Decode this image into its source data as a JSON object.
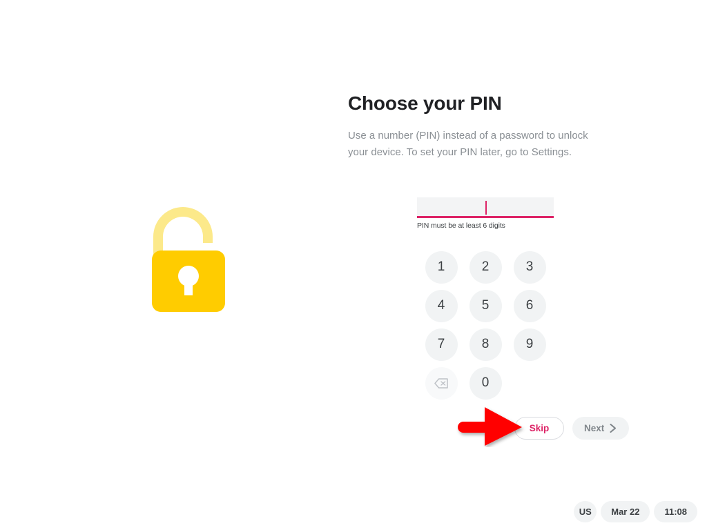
{
  "screen": {
    "title": "Choose your PIN",
    "subtitle": "Use a number (PIN) instead of a password to unlock your device. To set your PIN later, go to Settings."
  },
  "illustration": {
    "icon": "open-padlock-icon",
    "body_color": "#FFCC00",
    "shackle_color": "#FCE98A",
    "keyhole_color": "#FFFFFF"
  },
  "pin_field": {
    "value": "",
    "placeholder": "",
    "hint": "PIN must be at least 6 digits",
    "underline_color": "#DD2366",
    "caret_color": "#DD2366",
    "background": "#F3F4F5"
  },
  "keypad": {
    "keys": [
      {
        "label": "1",
        "name": "keypad-key-1",
        "type": "digit"
      },
      {
        "label": "2",
        "name": "keypad-key-2",
        "type": "digit"
      },
      {
        "label": "3",
        "name": "keypad-key-3",
        "type": "digit"
      },
      {
        "label": "4",
        "name": "keypad-key-4",
        "type": "digit"
      },
      {
        "label": "5",
        "name": "keypad-key-5",
        "type": "digit"
      },
      {
        "label": "6",
        "name": "keypad-key-6",
        "type": "digit"
      },
      {
        "label": "7",
        "name": "keypad-key-7",
        "type": "digit"
      },
      {
        "label": "8",
        "name": "keypad-key-8",
        "type": "digit"
      },
      {
        "label": "9",
        "name": "keypad-key-9",
        "type": "digit"
      },
      {
        "label": "⌫",
        "name": "keypad-key-backspace",
        "type": "backspace"
      },
      {
        "label": "0",
        "name": "keypad-key-0",
        "type": "digit"
      },
      {
        "label": "",
        "name": "keypad-key-spacer",
        "type": "empty"
      }
    ],
    "key_background": "#F1F3F4",
    "key_text_color": "#3C4043"
  },
  "actions": {
    "skip_label": "Skip",
    "skip_color": "#DD2366",
    "next_label": "Next",
    "next_icon": "chevron-right-icon",
    "next_disabled": true
  },
  "annotation": {
    "arrow": "red-pointer-arrow",
    "color": "#FF0000",
    "points_to": "Skip"
  },
  "status_bar": {
    "locale": "US",
    "date": "Mar 22",
    "time": "11:08"
  }
}
